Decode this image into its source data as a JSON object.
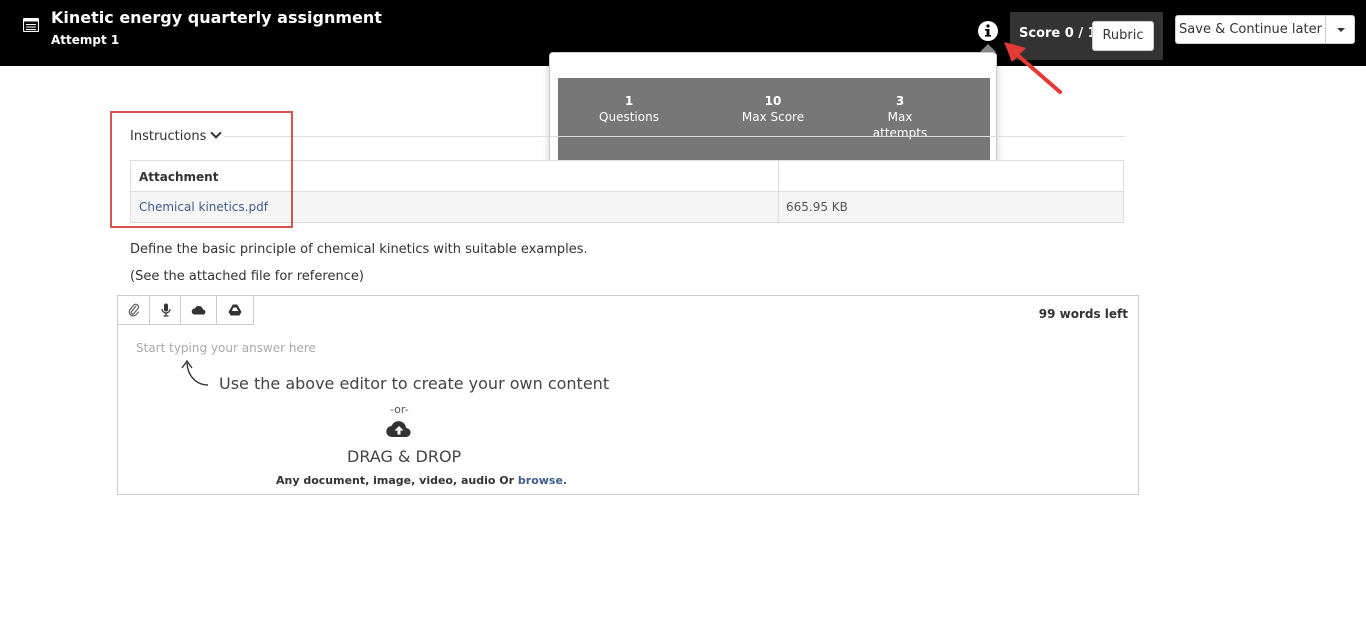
{
  "header": {
    "title": "Kinetic energy quarterly assignment",
    "subtitle": "Attempt 1",
    "score_label": "Score 0 / 10",
    "rubric_label": "Rubric",
    "save_label": "Save & Continue later"
  },
  "popover": {
    "stats": [
      {
        "value": "1",
        "label": "Questions"
      },
      {
        "value": "10",
        "label": "Max Score"
      },
      {
        "value": "3",
        "label": "Max attempts"
      }
    ]
  },
  "instructions": {
    "label": "Instructions",
    "attachment_header": "Attachment",
    "attachment": {
      "name": "Chemical kinetics.pdf",
      "size": "665.95 KB"
    }
  },
  "question": {
    "text": "Define the basic principle of chemical kinetics with suitable examples.",
    "reference": "(See the attached file for reference)"
  },
  "editor": {
    "words_left": "99 words left",
    "placeholder": "Start typing your answer here",
    "hint": "Use the above editor to create your own content",
    "or_text": "-or-",
    "drag_drop_title": "DRAG & DROP",
    "drag_drop_sub": "Any document, image, video, audio Or",
    "browse_link": "browse.",
    "toolbar_icons": [
      "paperclip-icon",
      "microphone-icon",
      "onedrive-icon",
      "google-drive-icon"
    ]
  },
  "colors": {
    "header_bg": "#000000",
    "score_bg": "#333333",
    "stats_bg": "#777777",
    "link": "#3f5d8c",
    "highlight": "#d9534f",
    "annotation_arrow": "#e53935"
  }
}
